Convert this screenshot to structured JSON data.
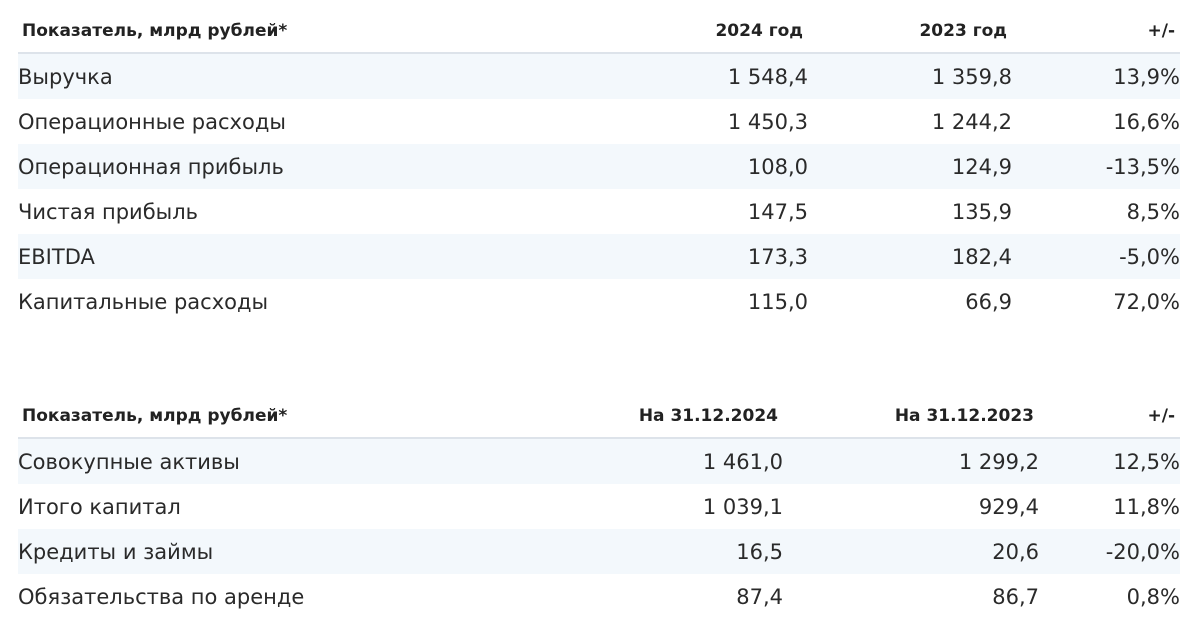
{
  "income_table": {
    "headers": [
      "Показатель, млрд рублей*",
      "2024 год",
      "2023 год",
      "+/-"
    ],
    "rows": [
      [
        "Выручка",
        "1 548,4",
        "1 359,8",
        "13,9%"
      ],
      [
        "Операционные расходы",
        "1 450,3",
        "1 244,2",
        "16,6%"
      ],
      [
        "Операционная прибыль",
        "108,0",
        "124,9",
        "-13,5%"
      ],
      [
        "Чистая прибыль",
        "147,5",
        "135,9",
        "8,5%"
      ],
      [
        "EBITDA",
        "173,3",
        "182,4",
        "-5,0%"
      ],
      [
        "Капитальные расходы",
        "115,0",
        "66,9",
        "72,0%"
      ]
    ]
  },
  "balance_table": {
    "headers": [
      "Показатель, млрд рублей*",
      "На 31.12.2024",
      "На 31.12.2023",
      "+/-"
    ],
    "rows": [
      [
        "Совокупные активы",
        "1 461,0",
        "1 299,2",
        "12,5%"
      ],
      [
        "Итого капитал",
        "1 039,1",
        "929,4",
        "11,8%"
      ],
      [
        "Кредиты и займы",
        "16,5",
        "20,6",
        "-20,0%"
      ],
      [
        "Обязательства по аренде",
        "87,4",
        "86,7",
        "0,8%"
      ]
    ]
  }
}
